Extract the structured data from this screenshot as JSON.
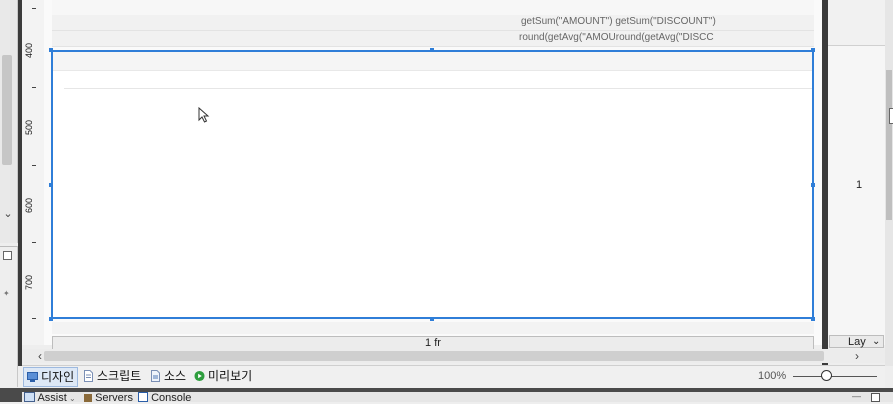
{
  "ruler": {
    "labels": [
      "400",
      "500",
      "600",
      "700"
    ]
  },
  "report": {
    "sum_row": "getSum(\"AMOUNT\") getSum(\"DISCOUNT\")",
    "avg_row": "round(getAvg(\"AMOUround(getAvg(\"DISCC"
  },
  "grid": {
    "fr_label": "1 fr",
    "row_value": "1",
    "layout_tab": "Lay"
  },
  "tabs": [
    {
      "label": "디자인",
      "icon": "design-icon",
      "active": true
    },
    {
      "label": "스크립트",
      "icon": "script-file-icon",
      "active": false
    },
    {
      "label": "소스",
      "icon": "source-file-icon",
      "active": false
    },
    {
      "label": "미리보기",
      "icon": "play-preview-icon",
      "active": false
    }
  ],
  "zoom": {
    "level": "100%",
    "fraction": 0.4
  },
  "bottom_views": [
    {
      "label": "Assist",
      "icon": "assist-icon"
    },
    {
      "label": "Servers",
      "icon": "servers-icon"
    },
    {
      "label": "Console",
      "icon": "console-icon"
    }
  ],
  "colors": {
    "selection": "#2f7ed8",
    "frame": "#3b3b3b",
    "preview_icon": "#2e9e3e"
  }
}
